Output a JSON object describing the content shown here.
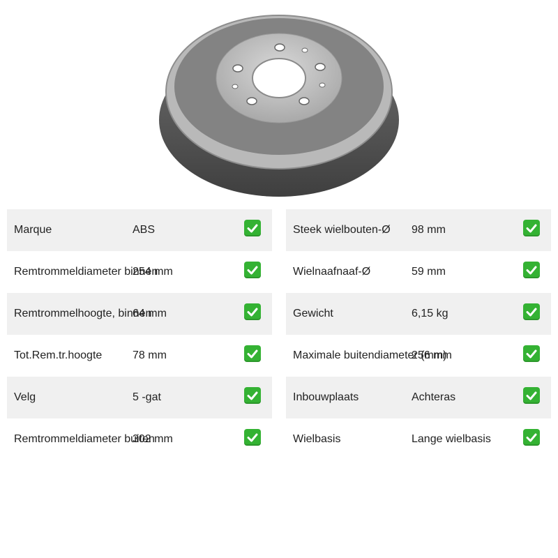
{
  "product_image": {
    "alt": "brake-drum"
  },
  "left_specs": [
    {
      "label": "Marque",
      "value": "ABS",
      "status": "check-icon"
    },
    {
      "label": "Remtrommeldiameter binnen",
      "value": "254 mm",
      "status": "check-icon"
    },
    {
      "label": "Remtrommelhoogte, binnen",
      "value": "64 mm",
      "status": "check-icon"
    },
    {
      "label": "Tot.Rem.tr.hoogte",
      "value": "78 mm",
      "status": "check-icon"
    },
    {
      "label": "Velg",
      "value": "5 -gat",
      "status": "check-icon"
    },
    {
      "label": "Remtrommeldiameter buiten",
      "value": "302 mm",
      "status": "check-icon"
    }
  ],
  "right_specs": [
    {
      "label": "Steek wielbouten-Ø",
      "value": "98 mm",
      "status": "check-icon"
    },
    {
      "label": "Wielnaafnaaf-Ø",
      "value": "59 mm",
      "status": "check-icon"
    },
    {
      "label": "Gewicht",
      "value": "6,15 kg",
      "status": "check-icon"
    },
    {
      "label": "Maximale buitendiameter (mm)",
      "value": "256 mm",
      "status": "check-icon"
    },
    {
      "label": "Inbouwplaats",
      "value": "Achteras",
      "status": "check-icon"
    },
    {
      "label": "Wielbasis",
      "value": "Lange wielbasis",
      "status": "check-icon"
    }
  ],
  "colors": {
    "shaded_row": "#f0f0f0",
    "check": "#34b233"
  }
}
